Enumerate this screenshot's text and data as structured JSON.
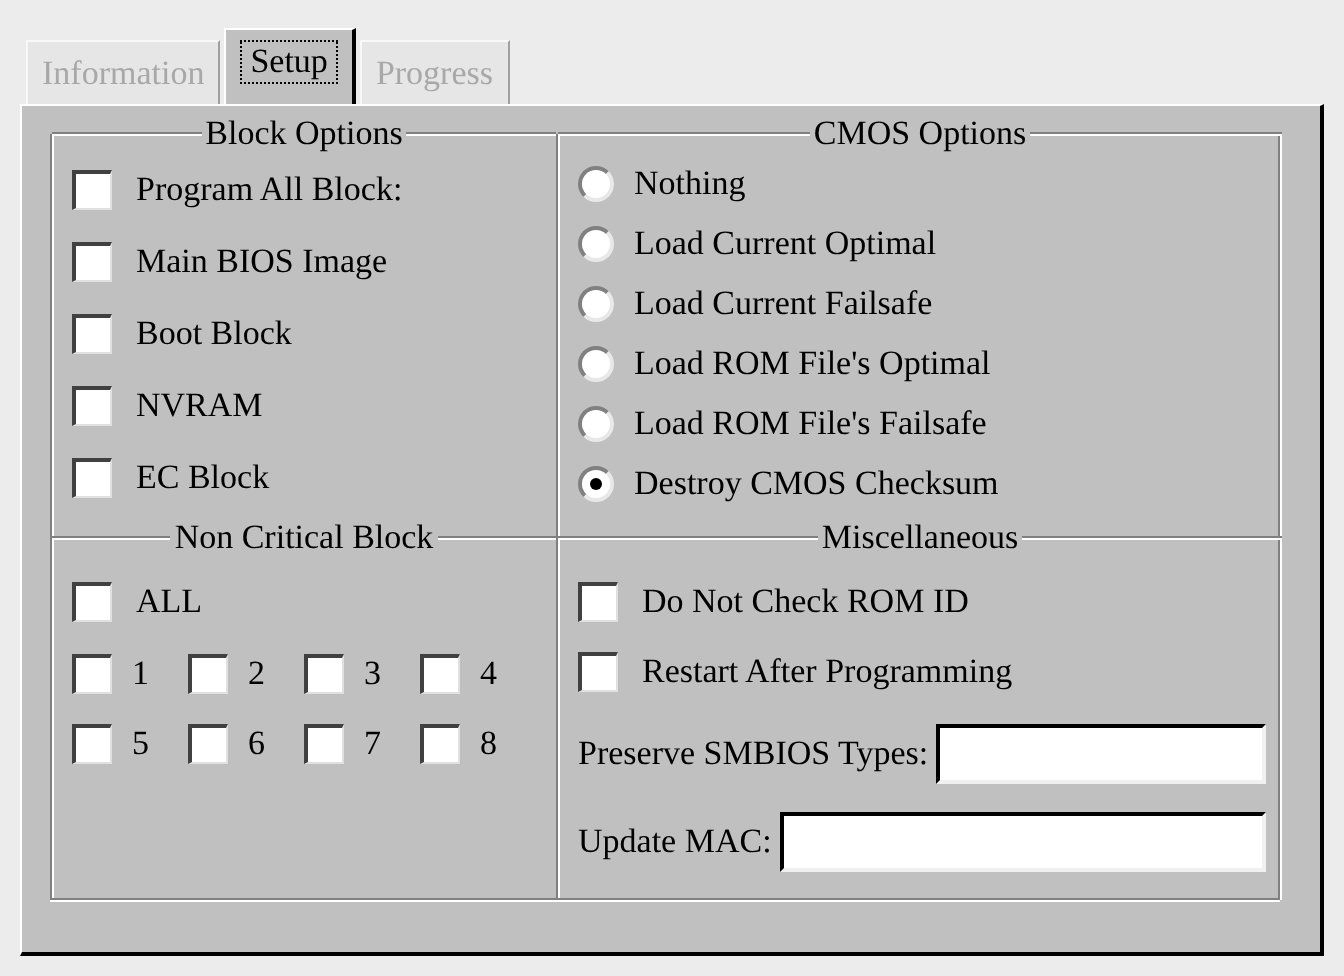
{
  "tabs": [
    {
      "label": "Information",
      "selected": false,
      "disabled": true
    },
    {
      "label": "Setup",
      "selected": true,
      "disabled": false
    },
    {
      "label": "Progress",
      "selected": false,
      "disabled": true
    }
  ],
  "block_options": {
    "title": "Block Options",
    "items": [
      {
        "label": "Program All Block:",
        "checked": false
      },
      {
        "label": "Main BIOS Image",
        "checked": false
      },
      {
        "label": "Boot Block",
        "checked": false
      },
      {
        "label": "NVRAM",
        "checked": false
      },
      {
        "label": "EC Block",
        "checked": false
      }
    ]
  },
  "cmos_options": {
    "title": "CMOS Options",
    "options": [
      {
        "label": "Nothing",
        "selected": false
      },
      {
        "label": "Load Current Optimal",
        "selected": false
      },
      {
        "label": "Load Current Failsafe",
        "selected": false
      },
      {
        "label": "Load ROM File's Optimal",
        "selected": false
      },
      {
        "label": "Load ROM File's Failsafe",
        "selected": false
      },
      {
        "label": "Destroy CMOS Checksum",
        "selected": true
      }
    ]
  },
  "non_critical_block": {
    "title": "Non Critical Block",
    "all": {
      "label": "ALL",
      "checked": false
    },
    "blocks": [
      {
        "label": "1",
        "checked": false
      },
      {
        "label": "2",
        "checked": false
      },
      {
        "label": "3",
        "checked": false
      },
      {
        "label": "4",
        "checked": false
      },
      {
        "label": "5",
        "checked": false
      },
      {
        "label": "6",
        "checked": false
      },
      {
        "label": "7",
        "checked": false
      },
      {
        "label": "8",
        "checked": false
      }
    ]
  },
  "miscellaneous": {
    "title": "Miscellaneous",
    "checks": [
      {
        "label": "Do Not Check ROM ID",
        "checked": false
      },
      {
        "label": "Restart After Programming",
        "checked": false
      }
    ],
    "fields": [
      {
        "label": "Preserve SMBIOS Types:"
      },
      {
        "label": "Update MAC:"
      }
    ]
  }
}
